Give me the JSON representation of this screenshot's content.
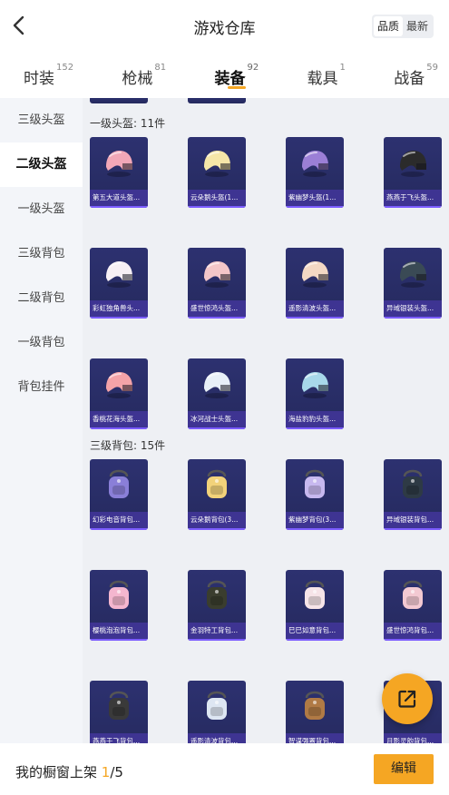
{
  "header": {
    "title": "游戏仓库",
    "back_icon": "chevron-left-icon"
  },
  "sort": {
    "options": [
      "品质",
      "最新"
    ],
    "active": "品质"
  },
  "tabs": [
    {
      "label": "时装",
      "count": "152"
    },
    {
      "label": "枪械",
      "count": "81"
    },
    {
      "label": "装备",
      "count": "92",
      "active": true
    },
    {
      "label": "载具",
      "count": "1"
    },
    {
      "label": "战备",
      "count": "59"
    }
  ],
  "sidebar": {
    "items": [
      {
        "label": "三级头盔"
      },
      {
        "label": "二级头盔",
        "active": true
      },
      {
        "label": "一级头盔"
      },
      {
        "label": "三级背包"
      },
      {
        "label": "二级背包"
      },
      {
        "label": "一级背包"
      },
      {
        "label": "背包挂件"
      }
    ]
  },
  "sections": [
    {
      "title": "一级头盔: 11件",
      "items": [
        {
          "name": "第五大道头盔...",
          "icon": "helmet-icon",
          "color": "#f2a7b7"
        },
        {
          "name": "云朵鹅头盔(1...",
          "icon": "helmet-icon",
          "color": "#f5e6a8"
        },
        {
          "name": "紫幽梦头盔(1...",
          "icon": "helmet-icon",
          "color": "#9b7fd6"
        },
        {
          "name": "燕燕于飞头盔...",
          "icon": "helmet-icon",
          "color": "#2b2b2b"
        },
        {
          "name": "彩虹独角兽头...",
          "icon": "helmet-icon",
          "color": "#f7f0f5"
        },
        {
          "name": "盛世惊鸿头盔...",
          "icon": "helmet-icon",
          "color": "#f3c6c8"
        },
        {
          "name": "遥影清波头盔...",
          "icon": "helmet-icon",
          "color": "#f3d8c4"
        },
        {
          "name": "异域银装头盔...",
          "icon": "helmet-icon",
          "color": "#3a4a55"
        },
        {
          "name": "香桃花海头盔...",
          "icon": "helmet-icon",
          "color": "#f4a3a8"
        },
        {
          "name": "冰河战士头盔...",
          "icon": "helmet-icon",
          "color": "#e8f0f7"
        },
        {
          "name": "海盐豹豹头盔...",
          "icon": "helmet-icon",
          "color": "#a8d8ea"
        }
      ]
    },
    {
      "title": "三级背包: 15件",
      "items": [
        {
          "name": "幻彩电音背包...",
          "icon": "backpack-icon",
          "color": "#8a7fd8"
        },
        {
          "name": "云朵鹅背包(3...",
          "icon": "backpack-icon",
          "color": "#f2d27a"
        },
        {
          "name": "紫幽梦背包(3...",
          "icon": "backpack-icon",
          "color": "#c7b8ef"
        },
        {
          "name": "异域银装背包...",
          "icon": "backpack-icon",
          "color": "#2e3a45"
        },
        {
          "name": "樱桃泡泡背包...",
          "icon": "backpack-icon",
          "color": "#f4b6cf"
        },
        {
          "name": "金羽特工背包...",
          "icon": "backpack-icon",
          "color": "#3a3d2e"
        },
        {
          "name": "巳巳如意背包...",
          "icon": "backpack-icon",
          "color": "#f6e4e8"
        },
        {
          "name": "盛世惊鸿背包...",
          "icon": "backpack-icon",
          "color": "#f3c9d2"
        },
        {
          "name": "燕燕于飞背包...",
          "icon": "backpack-icon",
          "color": "#3a3a3a"
        },
        {
          "name": "遥影清波背包...",
          "icon": "backpack-icon",
          "color": "#dde6f2"
        },
        {
          "name": "智谋强罴背包...",
          "icon": "backpack-icon",
          "color": "#b07a45"
        },
        {
          "name": "月影灵韵背包...",
          "icon": "backpack-icon",
          "color": "#cfd3e0"
        }
      ]
    }
  ],
  "bottom": {
    "shelf_label": "我的橱窗上架",
    "shelf_current": "1",
    "shelf_total": "/5",
    "edit_label": "编辑"
  },
  "fab": {
    "icon": "external-link-icon"
  },
  "colors": {
    "accent": "#f5a623",
    "card_bg": "#2d3170",
    "card_label_bg": "#3e3492",
    "sidebar_bg": "#f3f5f9",
    "content_bg": "#eef0f4"
  }
}
